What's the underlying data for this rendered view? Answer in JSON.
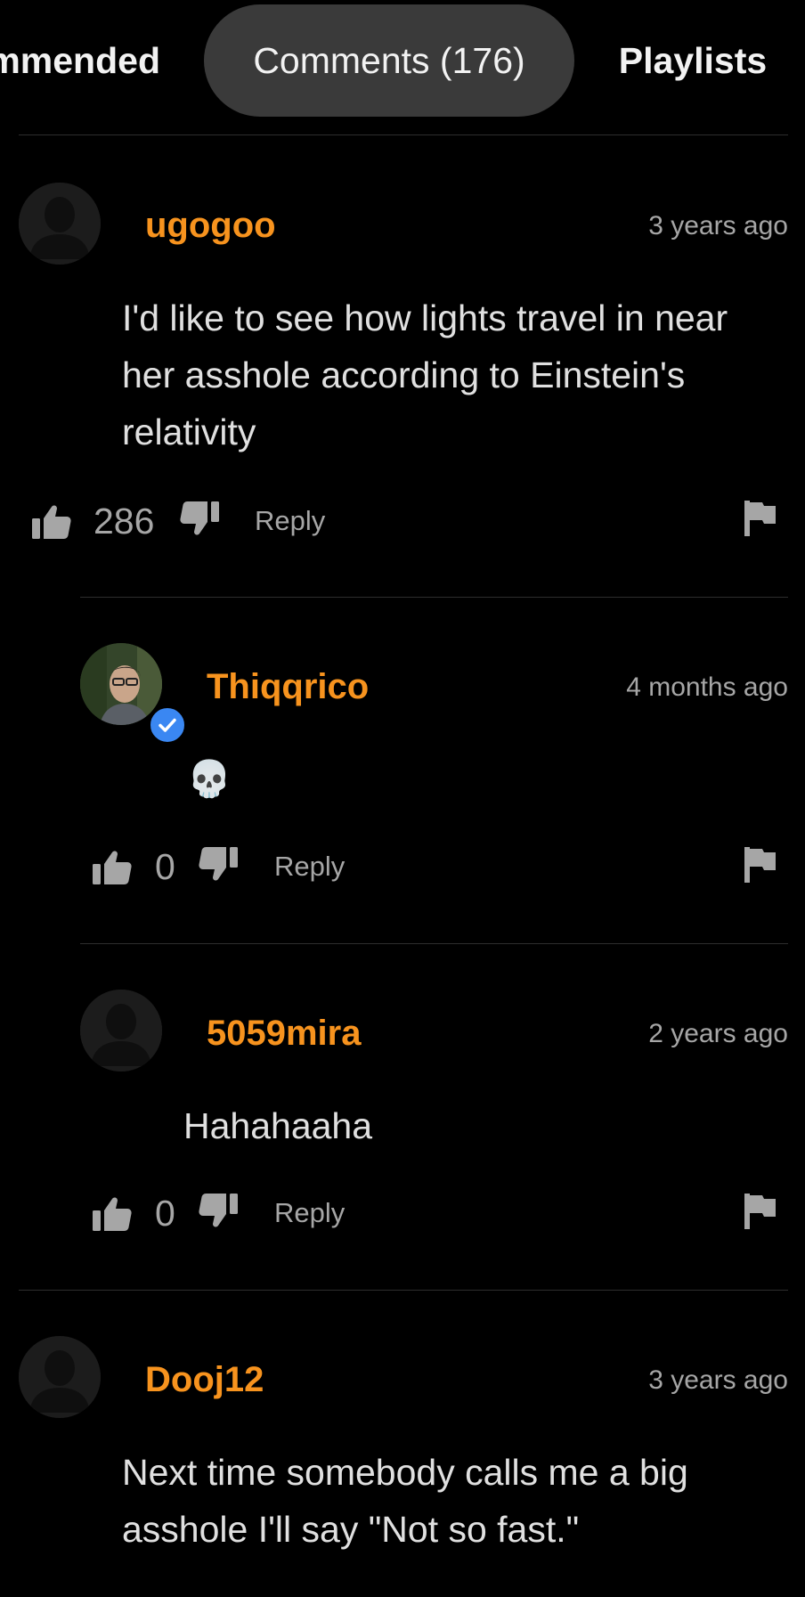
{
  "tabs": {
    "recommended": "mmended",
    "comments": "Comments (176)",
    "playlists": "Playlists"
  },
  "colors": {
    "background": "#000000",
    "active_tab_bg": "#3a3a3a",
    "username": "#f7931e",
    "muted_text": "#a6a6a6",
    "verified": "#3a87f2"
  },
  "comments": [
    {
      "username": "ugogoo",
      "time": "3 years ago",
      "text": "I'd like to see how lights travel in near her asshole according to Einstein's relativity",
      "likes": "286",
      "reply_label": "Reply",
      "avatar": "default-avatar-icon",
      "verified": false
    },
    {
      "username": "Thiqqrico",
      "time": "4 months ago",
      "text": "💀",
      "likes": "0",
      "reply_label": "Reply",
      "avatar": "profile-photo",
      "verified": true
    },
    {
      "username": "5059mira",
      "time": "2 years ago",
      "text": "Hahahaaha",
      "likes": "0",
      "reply_label": "Reply",
      "avatar": "default-avatar-icon",
      "verified": false
    },
    {
      "username": "Dooj12",
      "time": "3 years ago",
      "text": "Next time somebody calls me a big asshole I'll say \"Not so fast.\"",
      "avatar": "default-avatar-icon",
      "verified": false
    }
  ],
  "icons": {
    "like": "thumbs-up-icon",
    "dislike": "thumbs-down-icon",
    "report": "flag-icon",
    "verified": "checkmark-icon"
  }
}
